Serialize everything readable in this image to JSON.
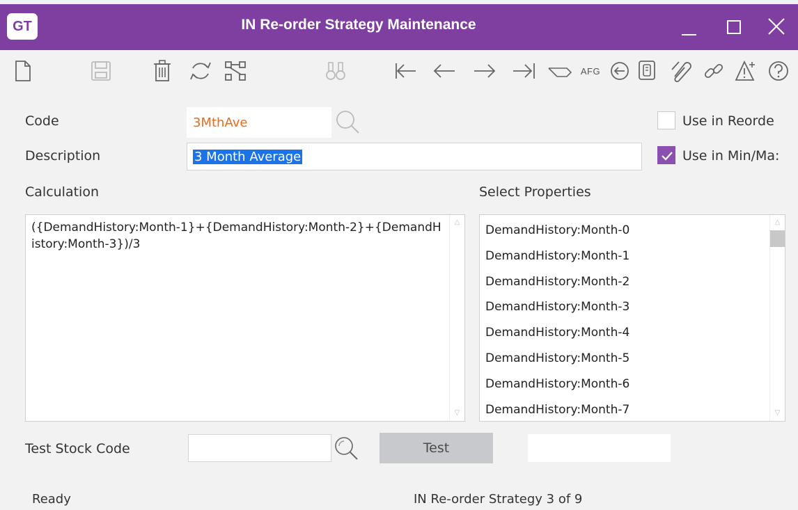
{
  "window": {
    "logo_text": "GT",
    "title": "IN Re-order Strategy Maintenance",
    "accent_color": "#7e3fa0"
  },
  "toolbar": {
    "icons": [
      "new-icon",
      "save-icon",
      "delete-icon",
      "refresh-icon",
      "tree-icon",
      "find-icon",
      "first-icon",
      "previous-icon",
      "next-icon",
      "last-icon",
      "tag-icon",
      "afg-icon",
      "back-circle-icon",
      "document-icon",
      "attach-icon",
      "link-icon",
      "warning-icon",
      "help-icon"
    ],
    "afg_label": "AFG"
  },
  "form": {
    "code_label": "Code",
    "code_value": "3MthAve",
    "description_label": "Description",
    "description_value": "3 Month Average",
    "use_in_reorder_label": "Use in Reorde",
    "use_in_reorder_checked": false,
    "use_in_minmax_label": "Use in Min/Ma:",
    "use_in_minmax_checked": true,
    "calculation_label": "Calculation",
    "calculation_value": "({DemandHistory:Month-1}+{DemandHistory:Month-2}+{DemandHistory:Month-3})/3",
    "select_properties_label": "Select Properties",
    "properties": [
      "DemandHistory:Month-0",
      "DemandHistory:Month-1",
      "DemandHistory:Month-2",
      "DemandHistory:Month-3",
      "DemandHistory:Month-4",
      "DemandHistory:Month-5",
      "DemandHistory:Month-6",
      "DemandHistory:Month-7"
    ],
    "test_stock_code_label": "Test Stock Code",
    "test_stock_code_value": "",
    "test_button_label": "Test",
    "test_result_value": ""
  },
  "status": {
    "left": "Ready",
    "right": "IN Re-order Strategy 3 of 9"
  }
}
